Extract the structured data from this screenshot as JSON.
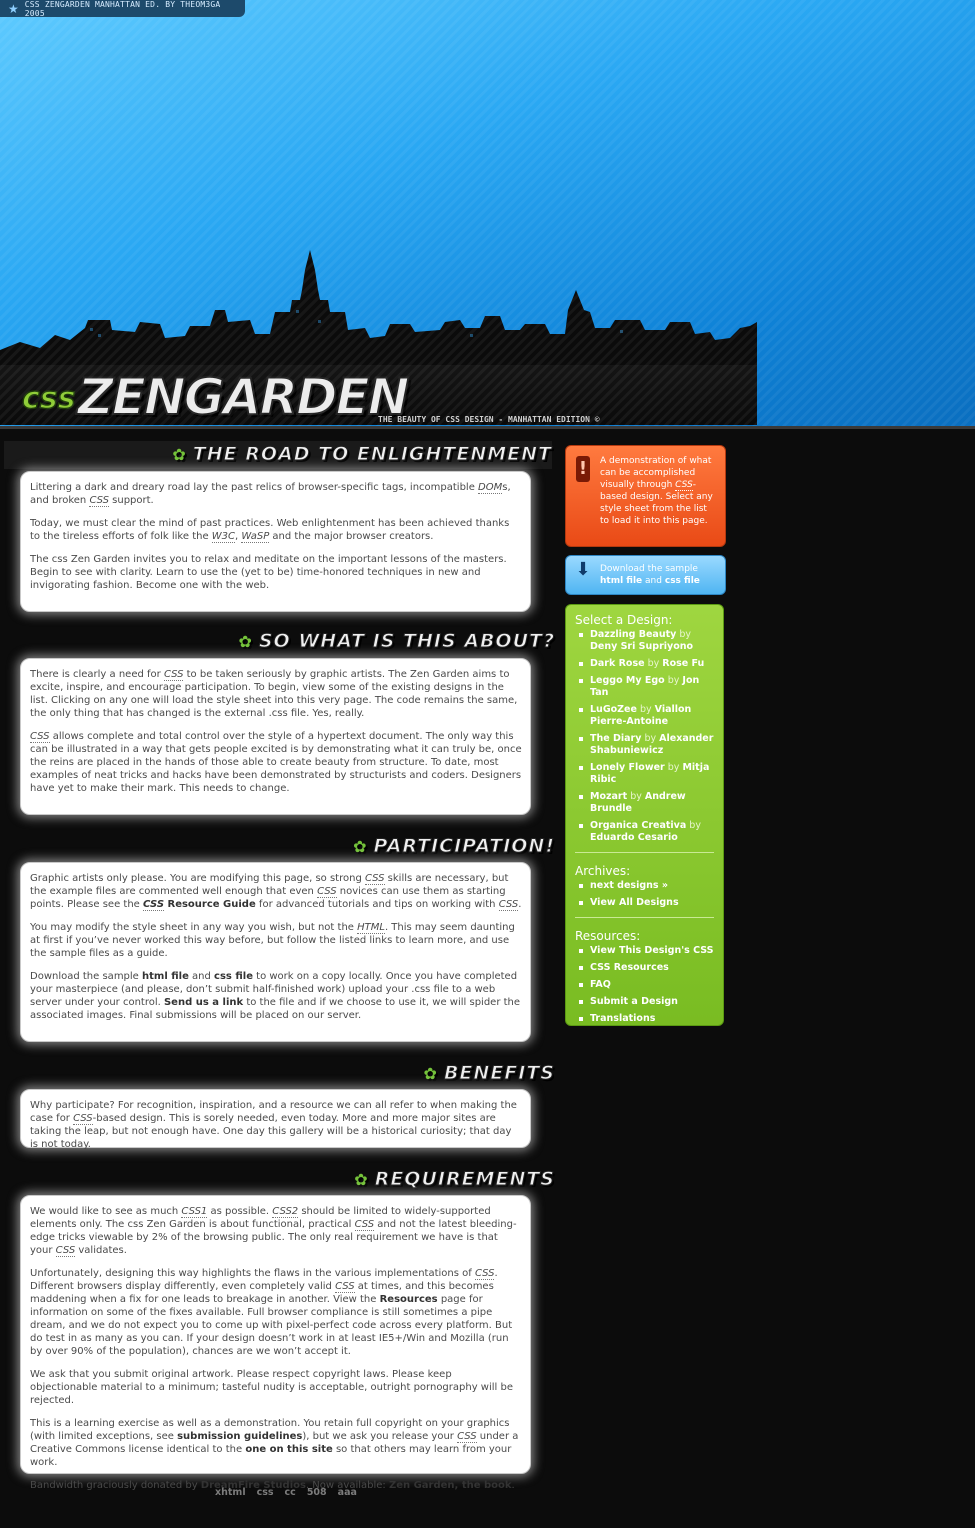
{
  "header": {
    "topbar": "CSS ZENGARDEN MANHATTAN ED. BY THEOM3GA 2005",
    "logo_css": "css",
    "logo_zen": "ZENGARDEN",
    "tagline": "THE BEAUTY OF CSS DESIGN - MANHATTAN EDITION ©"
  },
  "sections": [
    {
      "title": "THE ROAD TO ENLIGHTENMENT",
      "paragraphs": [
        "Littering a dark and dreary road lay the past relics of browser-specific tags, incompatible DOMs, and broken CSS support.",
        "Today, we must clear the mind of past practices. Web enlightenment has been achieved thanks to the tireless efforts of folk like the W3C, WaSP and the major browser creators.",
        "The css Zen Garden invites you to relax and meditate on the important lessons of the masters. Begin to see with clarity. Learn to use the (yet to be) time-honored techniques in new and invigorating fashion. Become one with the web."
      ]
    },
    {
      "title": "SO WHAT IS THIS ABOUT?",
      "paragraphs": [
        "There is clearly a need for CSS to be taken seriously by graphic artists. The Zen Garden aims to excite, inspire, and encourage participation. To begin, view some of the existing designs in the list. Clicking on any one will load the style sheet into this very page. The code remains the same, the only thing that has changed is the external .css file. Yes, really.",
        "CSS allows complete and total control over the style of a hypertext document. The only way this can be illustrated in a way that gets people excited is by demonstrating what it can truly be, once the reins are placed in the hands of those able to create beauty from structure. To date, most examples of neat tricks and hacks have been demonstrated by structurists and coders. Designers have yet to make their mark. This needs to change."
      ]
    },
    {
      "title": "PARTICIPATION!",
      "paragraphs": [
        "Graphic artists only please. You are modifying this page, so strong CSS skills are necessary, but the example files are commented well enough that even CSS novices can use them as starting points. Please see the CSS Resource Guide for advanced tutorials and tips on working with CSS.",
        "You may modify the style sheet in any way you wish, but not the HTML. This may seem daunting at first if you've never worked this way before, but follow the listed links to learn more, and use the sample files as a guide.",
        "Download the sample html file and css file to work on a copy locally. Once you have completed your masterpiece (and please, don't submit half-finished work) upload your .css file to a web server under your control. Send us a link to the file and if we choose to use it, we will spider the associated images. Final submissions will be placed on our server."
      ]
    },
    {
      "title": "BENEFITS",
      "paragraphs": [
        "Why participate? For recognition, inspiration, and a resource we can all refer to when making the case for CSS-based design. This is sorely needed, even today. More and more major sites are taking the leap, but not enough have. One day this gallery will be a historical curiosity; that day is not today."
      ]
    },
    {
      "title": "REQUIREMENTS",
      "paragraphs": [
        "We would like to see as much CSS1 as possible. CSS2 should be limited to widely-supported elements only. The css Zen Garden is about functional, practical CSS and not the latest bleeding-edge tricks viewable by 2% of the browsing public. The only real requirement we have is that your CSS validates.",
        "Unfortunately, designing this way highlights the flaws in the various implementations of CSS. Different browsers display differently, even completely valid CSS at times, and this becomes maddening when a fix for one leads to breakage in another. View the Resources page for information on some of the fixes available. Full browser compliance is still sometimes a pipe dream, and we do not expect you to come up with pixel-perfect code across every platform. But do test in as many as you can. If your design doesn't work in at least IE5+/Win and Mozilla (run by over 90% of the population), chances are we won't accept it.",
        "We ask that you submit original artwork. Please respect copyright laws. Please keep objectionable material to a minimum; tasteful nudity is acceptable, outright pornography will be rejected.",
        "This is a learning exercise as well as a demonstration. You retain full copyright on your graphics (with limited exceptions, see submission guidelines), but we ask you release your CSS under a Creative Commons license identical to the one on this site so that others may learn from your work.",
        "Bandwidth graciously donated by DreamFire Studios. Now available: Zen Garden, the book."
      ]
    }
  ],
  "sidebar": {
    "notice": "A demonstration of what can be accomplished visually through CSS-based design. Select any style sheet from the list to load it into this page.",
    "download_prefix": "Download the sample",
    "download_html": "html file",
    "download_and": "and",
    "download_css": "css file",
    "select_title": "Select a Design:",
    "designs": [
      {
        "name": "Dazzling Beauty",
        "by": "by",
        "author": "Deny Sri Supriyono"
      },
      {
        "name": "Dark Rose",
        "by": "by",
        "author": "Rose Fu"
      },
      {
        "name": "Leggo My Ego",
        "by": "by",
        "author": "Jon Tan"
      },
      {
        "name": "LuGoZee",
        "by": "by",
        "author": "Viallon Pierre-Antoine"
      },
      {
        "name": "The Diary",
        "by": "by",
        "author": "Alexander Shabuniewicz"
      },
      {
        "name": "Lonely Flower",
        "by": "by",
        "author": "Mitja Ribic"
      },
      {
        "name": "Mozart",
        "by": "by",
        "author": "Andrew Brundle"
      },
      {
        "name": "Organica Creativa",
        "by": "by",
        "author": "Eduardo Cesario"
      }
    ],
    "archives_title": "Archives:",
    "archives": [
      "next designs »",
      "View All Designs"
    ],
    "resources_title": "Resources:",
    "resources": [
      "View This Design's CSS",
      "CSS Resources",
      "FAQ",
      "Submit a Design",
      "Translations"
    ]
  },
  "footer": [
    "xhtml",
    "css",
    "cc",
    "508",
    "aaa"
  ],
  "colors": {
    "sky": "#2aa8f3",
    "notice_red": "#e94a16",
    "download_blue": "#4fb5f2",
    "select_green": "#79bc22",
    "page_bg": "#0c0c0c"
  }
}
